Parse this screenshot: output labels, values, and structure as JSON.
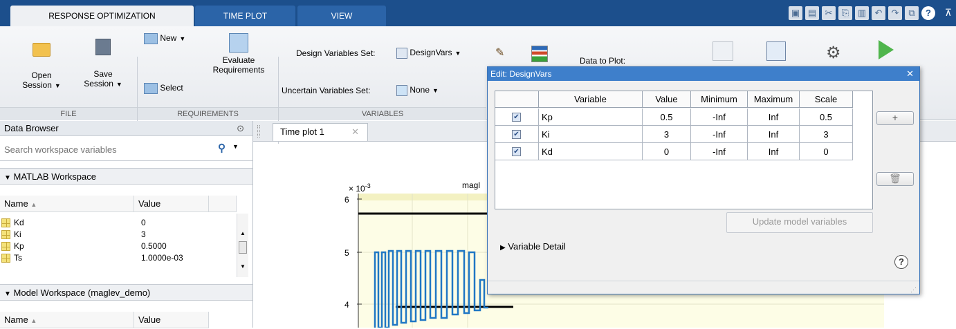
{
  "tabs": [
    "RESPONSE OPTIMIZATION",
    "TIME PLOT",
    "VIEW"
  ],
  "ribbon": {
    "open_session": [
      "Open",
      "Session"
    ],
    "save_session": [
      "Save",
      "Session"
    ],
    "new_label": "New",
    "select_label": "Select",
    "evaluate": [
      "Evaluate",
      "Requirements"
    ],
    "design_vars_label": "Design Variables Set:",
    "design_vars_value": "DesignVars",
    "uncertain_label": "Uncertain Variables Set:",
    "uncertain_value": "None",
    "data_to_plot": "Data to Plot:",
    "sections": {
      "file": "FILE",
      "requirements": "REQUIREMENTS",
      "variables": "VARIABLES"
    }
  },
  "data_browser": {
    "title": "Data Browser",
    "search_placeholder": "Search workspace variables",
    "matlab_ws": "MATLAB Workspace",
    "col_name": "Name",
    "col_value": "Value",
    "rows": [
      {
        "name": "Kd",
        "value": "0"
      },
      {
        "name": "Ki",
        "value": "3"
      },
      {
        "name": "Kp",
        "value": "0.5000"
      },
      {
        "name": "Ts",
        "value": "1.0000e-03"
      }
    ],
    "model_ws": "Model Workspace (maglev_demo)"
  },
  "doc_tab": "Time plot 1",
  "plot": {
    "title_partial": "magl",
    "exponent": "× 10",
    "exponent_power": "-3",
    "yticks": [
      "6",
      "5",
      "4"
    ]
  },
  "dialog": {
    "title": "Edit: DesignVars",
    "columns": [
      "Variable",
      "Value",
      "Minimum",
      "Maximum",
      "Scale"
    ],
    "rows": [
      {
        "variable": "Kp",
        "value": "0.5",
        "min": "-Inf",
        "max": "Inf",
        "scale": "0.5",
        "checked": true
      },
      {
        "variable": "Ki",
        "value": "3",
        "min": "-Inf",
        "max": "Inf",
        "scale": "3",
        "checked": true
      },
      {
        "variable": "Kd",
        "value": "0",
        "min": "-Inf",
        "max": "Inf",
        "scale": "0",
        "checked": true
      }
    ],
    "update_button": "Update model variables",
    "variable_detail": "Variable Detail"
  },
  "colors": {
    "tabbar": "#1c4f8c",
    "dialog_title": "#3e7fcb",
    "signal": "#1f77c4"
  }
}
